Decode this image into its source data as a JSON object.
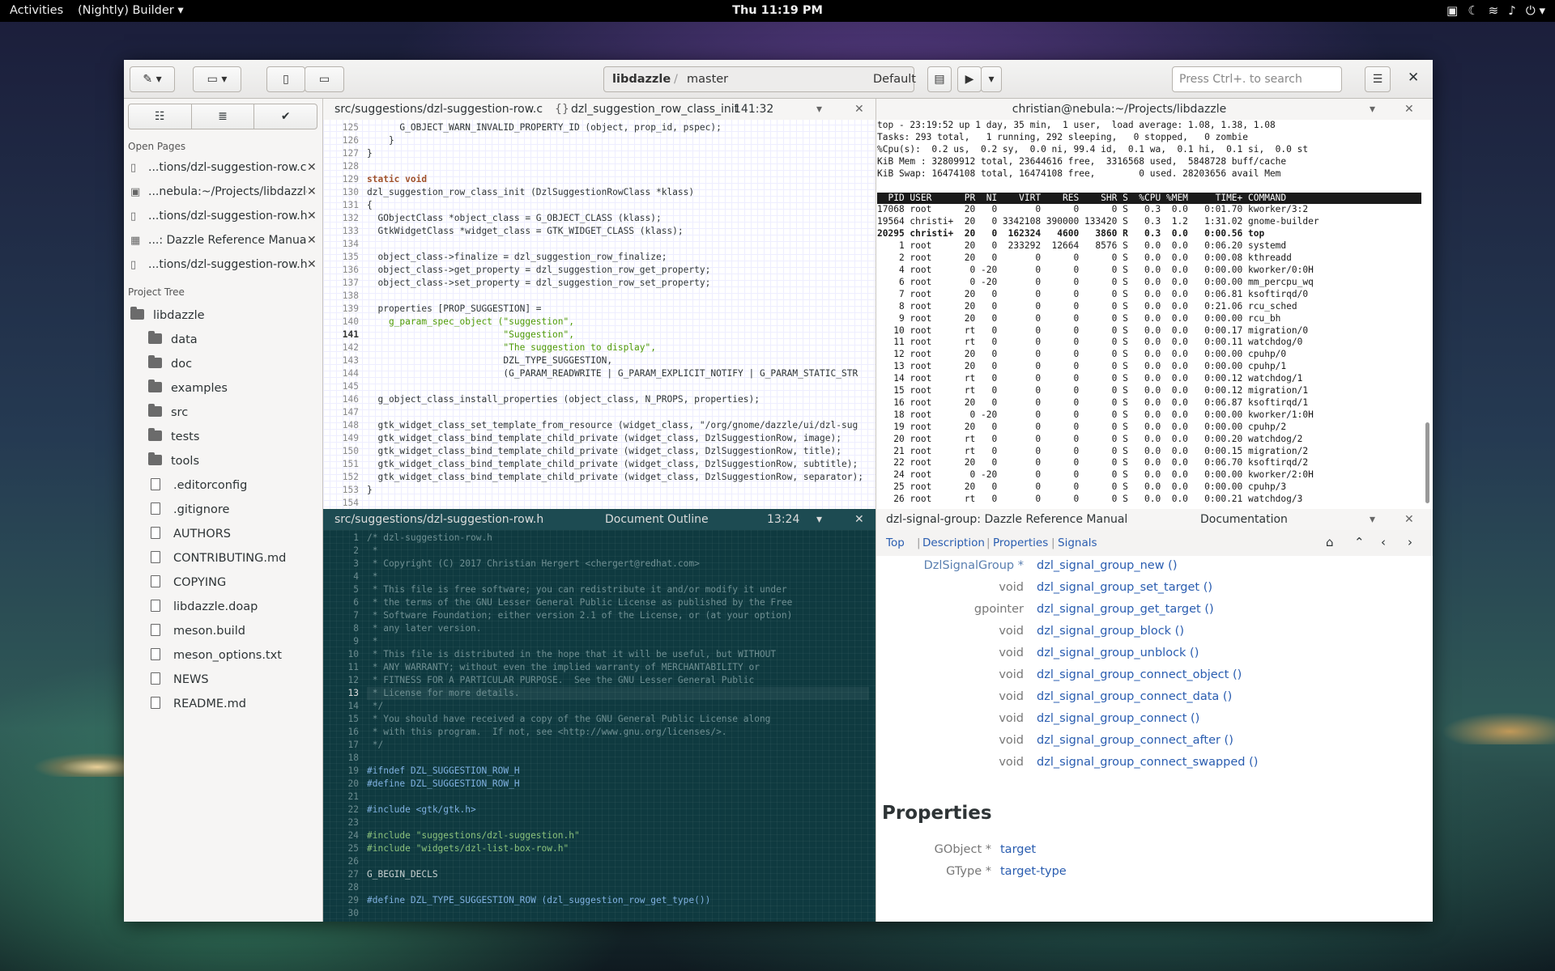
{
  "topbar": {
    "activities": "Activities",
    "app": "(Nightly) Builder ▾",
    "clock": "Thu 11:19 PM"
  },
  "header": {
    "project": "libdazzle",
    "sep": "/",
    "branch": "master",
    "config": "Default",
    "search_placeholder": "Press Ctrl+. to search"
  },
  "sidebar": {
    "open_pages_label": "Open Pages",
    "open_pages": [
      "...tions/dzl-suggestion-row.c",
      "...nebula:~/Projects/libdazzle",
      "...tions/dzl-suggestion-row.h",
      "...: Dazzle Reference Manual",
      "...tions/dzl-suggestion-row.h"
    ],
    "project_tree_label": "Project Tree",
    "root": "libdazzle",
    "folders": [
      "data",
      "doc",
      "examples",
      "src",
      "tests",
      "tools"
    ],
    "files": [
      ".editorconfig",
      ".gitignore",
      "AUTHORS",
      "CONTRIBUTING.md",
      "COPYING",
      "libdazzle.doap",
      "meson.build",
      "meson_options.txt",
      "NEWS",
      "README.md"
    ]
  },
  "editor_top": {
    "path": "src/suggestions/dzl-suggestion-row.c",
    "symbol": "dzl_suggestion_row_class_init",
    "pos": "141:32",
    "lines": [
      [
        "125",
        "      G_OBJECT_WARN_INVALID_PROPERTY_ID (object, prop_id, pspec);"
      ],
      [
        "126",
        "    }"
      ],
      [
        "127",
        "}"
      ],
      [
        "128",
        ""
      ],
      [
        "129",
        "static void"
      ],
      [
        "130",
        "dzl_suggestion_row_class_init (DzlSuggestionRowClass *klass)"
      ],
      [
        "131",
        "{"
      ],
      [
        "132",
        "  GObjectClass *object_class = G_OBJECT_CLASS (klass);"
      ],
      [
        "133",
        "  GtkWidgetClass *widget_class = GTK_WIDGET_CLASS (klass);"
      ],
      [
        "134",
        ""
      ],
      [
        "135",
        "  object_class->finalize = dzl_suggestion_row_finalize;"
      ],
      [
        "136",
        "  object_class->get_property = dzl_suggestion_row_get_property;"
      ],
      [
        "137",
        "  object_class->set_property = dzl_suggestion_row_set_property;"
      ],
      [
        "138",
        ""
      ],
      [
        "139",
        "  properties [PROP_SUGGESTION] ="
      ],
      [
        "140",
        "    g_param_spec_object (\"suggestion\","
      ],
      [
        "141",
        "                         \"Suggestion\","
      ],
      [
        "142",
        "                         \"The suggestion to display\","
      ],
      [
        "143",
        "                         DZL_TYPE_SUGGESTION,"
      ],
      [
        "144",
        "                         (G_PARAM_READWRITE | G_PARAM_EXPLICIT_NOTIFY | G_PARAM_STATIC_STR"
      ],
      [
        "145",
        ""
      ],
      [
        "146",
        "  g_object_class_install_properties (object_class, N_PROPS, properties);"
      ],
      [
        "147",
        ""
      ],
      [
        "148",
        "  gtk_widget_class_set_template_from_resource (widget_class, \"/org/gnome/dazzle/ui/dzl-sug"
      ],
      [
        "149",
        "  gtk_widget_class_bind_template_child_private (widget_class, DzlSuggestionRow, image);"
      ],
      [
        "150",
        "  gtk_widget_class_bind_template_child_private (widget_class, DzlSuggestionRow, title);"
      ],
      [
        "151",
        "  gtk_widget_class_bind_template_child_private (widget_class, DzlSuggestionRow, subtitle);"
      ],
      [
        "152",
        "  gtk_widget_class_bind_template_child_private (widget_class, DzlSuggestionRow, separator);"
      ],
      [
        "153",
        "}"
      ],
      [
        "154",
        ""
      ]
    ]
  },
  "editor_bottom": {
    "path": "src/suggestions/dzl-suggestion-row.h",
    "outline": "Document Outline",
    "pos": "13:24",
    "lines": [
      [
        "1",
        "/* dzl-suggestion-row.h"
      ],
      [
        "2",
        " *"
      ],
      [
        "3",
        " * Copyright (C) 2017 Christian Hergert <chergert@redhat.com>"
      ],
      [
        "4",
        " *"
      ],
      [
        "5",
        " * This file is free software; you can redistribute it and/or modify it under"
      ],
      [
        "6",
        " * the terms of the GNU Lesser General Public License as published by the Free"
      ],
      [
        "7",
        " * Software Foundation; either version 2.1 of the License, or (at your option)"
      ],
      [
        "8",
        " * any later version."
      ],
      [
        "9",
        " *"
      ],
      [
        "10",
        " * This file is distributed in the hope that it will be useful, but WITHOUT"
      ],
      [
        "11",
        " * ANY WARRANTY; without even the implied warranty of MERCHANTABILITY or"
      ],
      [
        "12",
        " * FITNESS FOR A PARTICULAR PURPOSE.  See the GNU Lesser General Public"
      ],
      [
        "13",
        " * License for more details."
      ],
      [
        "14",
        " */"
      ],
      [
        "15",
        " * You should have received a copy of the GNU General Public License along"
      ],
      [
        "16",
        " * with this program.  If not, see <http://www.gnu.org/licenses/>."
      ],
      [
        "17",
        " */"
      ],
      [
        "18",
        ""
      ],
      [
        "19",
        "#ifndef DZL_SUGGESTION_ROW_H"
      ],
      [
        "20",
        "#define DZL_SUGGESTION_ROW_H"
      ],
      [
        "21",
        ""
      ],
      [
        "22",
        "#include <gtk/gtk.h>"
      ],
      [
        "23",
        ""
      ],
      [
        "24",
        "#include \"suggestions/dzl-suggestion.h\""
      ],
      [
        "25",
        "#include \"widgets/dzl-list-box-row.h\""
      ],
      [
        "26",
        ""
      ],
      [
        "27",
        "G_BEGIN_DECLS"
      ],
      [
        "28",
        ""
      ],
      [
        "29",
        "#define DZL_TYPE_SUGGESTION_ROW (dzl_suggestion_row_get_type())"
      ],
      [
        "30",
        ""
      ]
    ]
  },
  "terminal": {
    "title": "christian@nebula:~/Projects/libdazzle",
    "summary": [
      "top - 23:19:52 up 1 day, 35 min,  1 user,  load average: 1.08, 1.38, 1.08",
      "Tasks: 293 total,   1 running, 292 sleeping,   0 stopped,   0 zombie",
      "%Cpu(s):  0.2 us,  0.2 sy,  0.0 ni, 99.4 id,  0.1 wa,  0.1 hi,  0.1 si,  0.0 st",
      "KiB Mem : 32809912 total, 23644616 free,  3316568 used,  5848728 buff/cache",
      "KiB Swap: 16474108 total, 16474108 free,        0 used. 28203656 avail Mem"
    ],
    "header": "  PID USER      PR  NI    VIRT    RES    SHR S  %CPU %MEM     TIME+ COMMAND                                 ",
    "rows": [
      "17068 root      20   0       0      0      0 S   0.3  0.0   0:01.70 kworker/3:2",
      "19564 christi+  20   0 3342108 390000 133420 S   0.3  1.2   1:31.02 gnome-builder",
      "20295 christi+  20   0  162324   4600   3860 R   0.3  0.0   0:00.56 top",
      "    1 root      20   0  233292  12664   8576 S   0.0  0.0   0:06.20 systemd",
      "    2 root      20   0       0      0      0 S   0.0  0.0   0:00.08 kthreadd",
      "    4 root       0 -20       0      0      0 S   0.0  0.0   0:00.00 kworker/0:0H",
      "    6 root       0 -20       0      0      0 S   0.0  0.0   0:00.00 mm_percpu_wq",
      "    7 root      20   0       0      0      0 S   0.0  0.0   0:06.81 ksoftirqd/0",
      "    8 root      20   0       0      0      0 S   0.0  0.0   0:21.06 rcu_sched",
      "    9 root      20   0       0      0      0 S   0.0  0.0   0:00.00 rcu_bh",
      "   10 root      rt   0       0      0      0 S   0.0  0.0   0:00.17 migration/0",
      "   11 root      rt   0       0      0      0 S   0.0  0.0   0:00.11 watchdog/0",
      "   12 root      20   0       0      0      0 S   0.0  0.0   0:00.00 cpuhp/0",
      "   13 root      20   0       0      0      0 S   0.0  0.0   0:00.00 cpuhp/1",
      "   14 root      rt   0       0      0      0 S   0.0  0.0   0:00.12 watchdog/1",
      "   15 root      rt   0       0      0      0 S   0.0  0.0   0:00.12 migration/1",
      "   16 root      20   0       0      0      0 S   0.0  0.0   0:06.87 ksoftirqd/1",
      "   18 root       0 -20       0      0      0 S   0.0  0.0   0:00.00 kworker/1:0H",
      "   19 root      20   0       0      0      0 S   0.0  0.0   0:00.00 cpuhp/2",
      "   20 root      rt   0       0      0      0 S   0.0  0.0   0:00.20 watchdog/2",
      "   21 root      rt   0       0      0      0 S   0.0  0.0   0:00.15 migration/2",
      "   22 root      20   0       0      0      0 S   0.0  0.0   0:06.70 ksoftirqd/2",
      "   24 root       0 -20       0      0      0 S   0.0  0.0   0:00.00 kworker/2:0H",
      "   25 root      20   0       0      0      0 S   0.0  0.0   0:00.00 cpuhp/3",
      "   26 root      rt   0       0      0      0 S   0.0  0.0   0:00.21 watchdog/3"
    ]
  },
  "docs": {
    "title": "dzl-signal-group: Dazzle Reference Manual",
    "kind": "Documentation",
    "nav": [
      "Top",
      "Description",
      "Properties",
      "Signals"
    ],
    "functions": [
      [
        "DzlSignalGroup *",
        "dzl_signal_group_new ()"
      ],
      [
        "void",
        "dzl_signal_group_set_target ()"
      ],
      [
        "gpointer",
        "dzl_signal_group_get_target ()"
      ],
      [
        "void",
        "dzl_signal_group_block ()"
      ],
      [
        "void",
        "dzl_signal_group_unblock ()"
      ],
      [
        "void",
        "dzl_signal_group_connect_object ()"
      ],
      [
        "void",
        "dzl_signal_group_connect_data ()"
      ],
      [
        "void",
        "dzl_signal_group_connect ()"
      ],
      [
        "void",
        "dzl_signal_group_connect_after ()"
      ],
      [
        "void",
        "dzl_signal_group_connect_swapped ()"
      ]
    ],
    "properties_heading": "Properties",
    "properties": [
      [
        "GObject *",
        "target"
      ],
      [
        "GType *",
        "target-type"
      ]
    ]
  }
}
